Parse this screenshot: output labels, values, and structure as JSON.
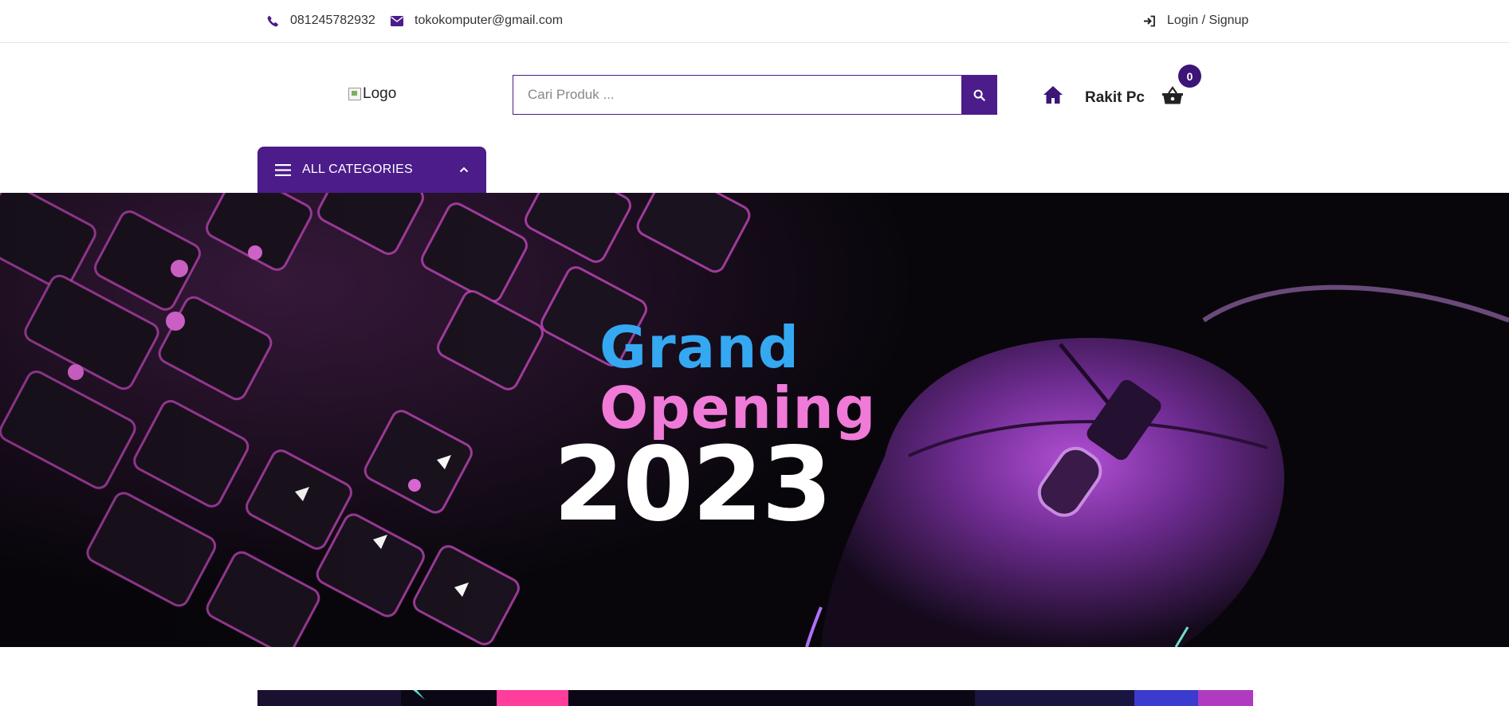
{
  "topbar": {
    "phone": "081245782932",
    "email": "tokokomputer@gmail.com",
    "login": "Login / Signup"
  },
  "header": {
    "logo_alt": "Logo",
    "search_placeholder": "Cari Produk ...",
    "rakit_label": "Rakit Pc",
    "cart_count": "0"
  },
  "categories": {
    "label": "ALL CATEGORIES"
  },
  "hero": {
    "line1": "Grand",
    "line2": "Opening",
    "year": "2023"
  },
  "colors": {
    "brand": "#4b1c8a",
    "badge": "#3d1478",
    "grand": "#35a8f2",
    "opening": "#f07ad8"
  },
  "icons": {
    "phone": "phone-icon",
    "email": "envelope-icon",
    "login": "sign-in-icon",
    "search": "search-icon",
    "home": "home-icon",
    "cart": "shopping-basket-icon",
    "menu": "hamburger-icon",
    "chevron": "chevron-up-icon"
  }
}
